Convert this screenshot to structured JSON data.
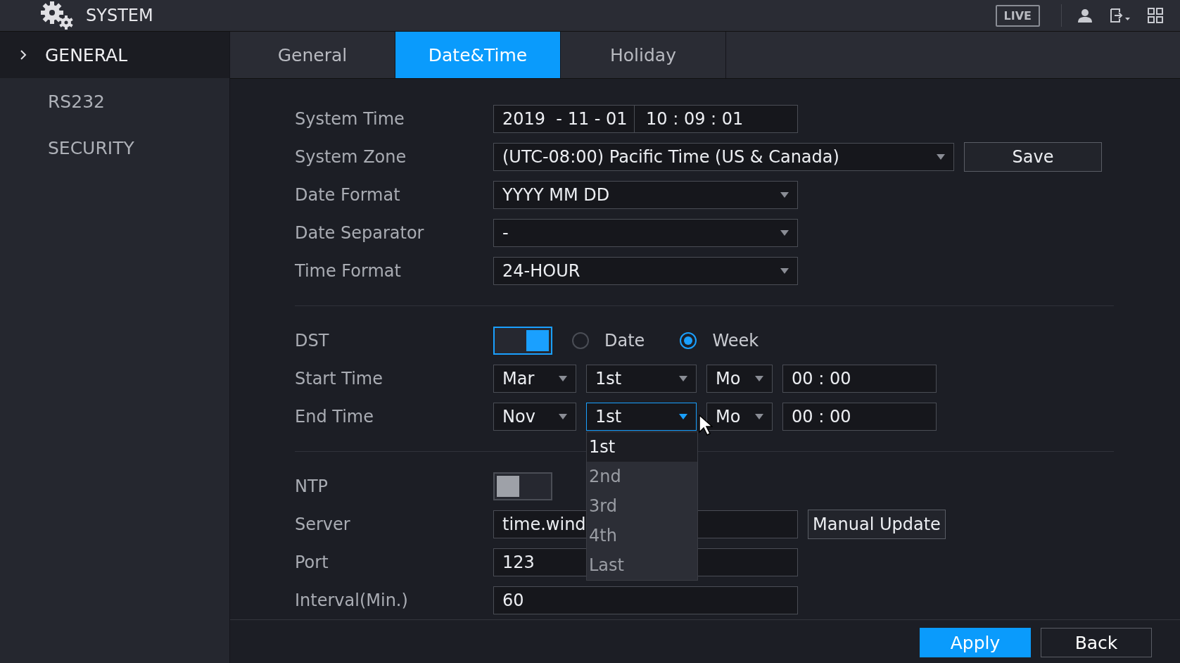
{
  "header": {
    "title": "SYSTEM",
    "live_label": "LIVE"
  },
  "sidebar": {
    "items": [
      {
        "label": "GENERAL",
        "selected": true,
        "expanded": true
      },
      {
        "label": "RS232",
        "selected": false,
        "expanded": false
      },
      {
        "label": "SECURITY",
        "selected": false,
        "expanded": false
      }
    ]
  },
  "tabs": [
    {
      "label": "General",
      "selected": false
    },
    {
      "label": "Date&Time",
      "selected": true
    },
    {
      "label": "Holiday",
      "selected": false
    }
  ],
  "system_time": {
    "label": "System Time",
    "date": "2019  - 11 - 01",
    "time": "10 : 09 : 01"
  },
  "system_zone": {
    "label": "System Zone",
    "value": "(UTC-08:00) Pacific Time (US & Canada)",
    "button": "Save"
  },
  "date_format": {
    "label": "Date Format",
    "value": "YYYY MM DD"
  },
  "date_separator": {
    "label": "Date Separator",
    "value": "-"
  },
  "time_format": {
    "label": "Time Format",
    "value": "24-HOUR"
  },
  "dst": {
    "label": "DST",
    "on": true,
    "modes": [
      {
        "label": "Date",
        "selected": false
      },
      {
        "label": "Week",
        "selected": true
      }
    ]
  },
  "start_time": {
    "label": "Start Time",
    "month": "Mar",
    "week": {
      "value": "1st",
      "open": false
    },
    "day": "Mo",
    "time": "00 : 00"
  },
  "end_time": {
    "label": "End Time",
    "month": "Nov",
    "week": {
      "value": "1st",
      "open": true,
      "options": [
        {
          "label": "1st",
          "selected": true
        },
        {
          "label": "2nd",
          "selected": false
        },
        {
          "label": "3rd",
          "selected": false
        },
        {
          "label": "4th",
          "selected": false
        },
        {
          "label": "Last",
          "selected": false
        }
      ]
    },
    "day": "Mo",
    "time": "00 : 00"
  },
  "ntp": {
    "label": "NTP",
    "on": false
  },
  "server": {
    "label": "Server",
    "value": "time.wind",
    "button": "Manual Update"
  },
  "port": {
    "label": "Port",
    "value": "123"
  },
  "interval": {
    "label": "Interval(Min.)",
    "value": "60"
  },
  "footer": {
    "buttons": [
      {
        "label": "Apply",
        "kind": "primary"
      },
      {
        "label": "Back",
        "kind": "secondary"
      }
    ]
  }
}
